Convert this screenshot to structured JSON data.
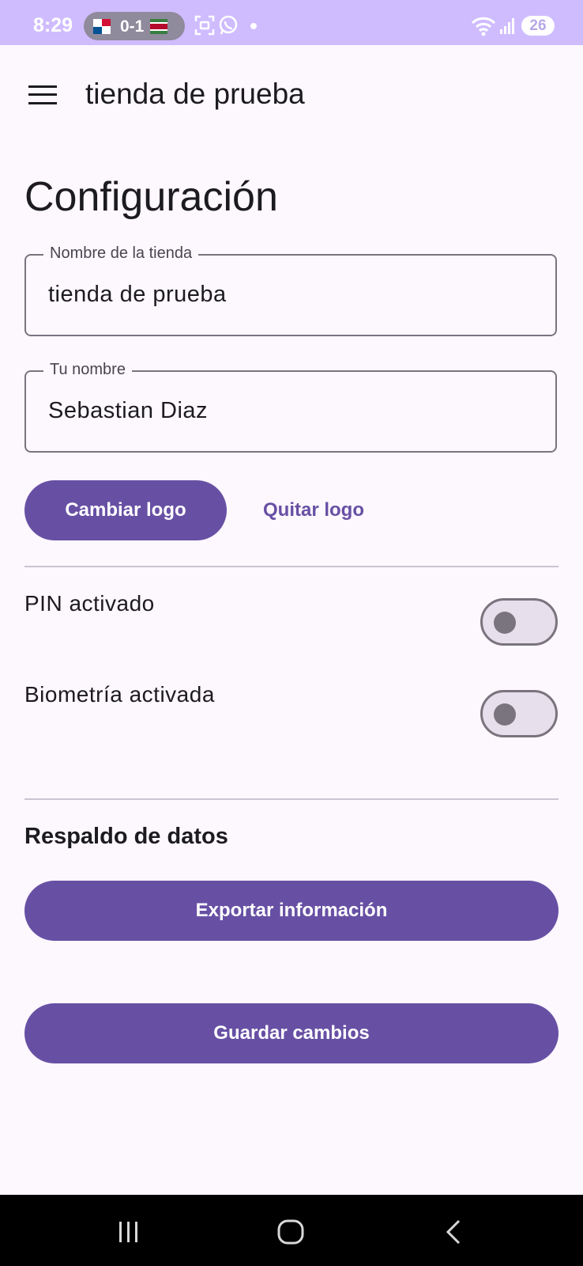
{
  "status_bar": {
    "time": "8:29",
    "score": "0-1",
    "battery": "26",
    "icons": [
      "panama-flag-icon",
      "suriname-flag-icon",
      "screenshot-icon",
      "whatsapp-icon",
      "notification-dot-icon",
      "wifi-icon",
      "signal-icon",
      "battery-icon"
    ]
  },
  "app_bar": {
    "title": "tienda de prueba",
    "menu_icon": "menu-icon"
  },
  "page": {
    "title": "Configuración"
  },
  "fields": {
    "store_name": {
      "label": "Nombre de la tienda",
      "value": "tienda de prueba"
    },
    "your_name": {
      "label": "Tu nombre",
      "value": "Sebastian Diaz"
    }
  },
  "logo": {
    "change_label": "Cambiar logo",
    "remove_label": "Quitar logo"
  },
  "toggles": {
    "pin": {
      "label": "PIN activado",
      "on": false
    },
    "biometrics": {
      "label": "Biometría activada",
      "on": false
    }
  },
  "backup": {
    "title": "Respaldo de datos",
    "export_label": "Exportar información"
  },
  "save_label": "Guardar cambios",
  "nav_bar": {
    "icons": [
      "recents-icon",
      "home-icon",
      "back-icon"
    ]
  },
  "colors": {
    "primary": "#6750a4",
    "status_bar": "#cfbcff",
    "background": "#fdf7fe",
    "outline": "#79747e"
  }
}
